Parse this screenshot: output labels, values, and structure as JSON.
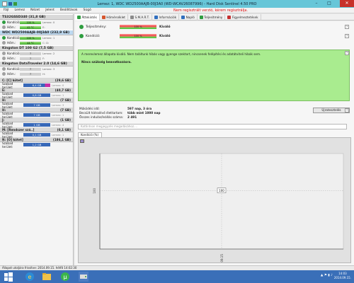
{
  "window": {
    "title": "Lemez: 1, WDC WD2500AAJB-00J3A0 (WD-WCAV26087996) - Hard Disk Sentinel 4.50 PRO",
    "min": "–",
    "max": "□",
    "close": "✕"
  },
  "menu": [
    "Fájl",
    "Lemez",
    "Nézet",
    "Jelent",
    "Beállítások",
    "Súgó"
  ],
  "nag": "Nem regisztrált verzió, kérem regisztrálja.",
  "devices": [
    {
      "name": "TS32GSSD340 (31,8 GB)",
      "selected": false,
      "rows": [
        {
          "label": "Kondíció:",
          "value": "100 %",
          "extra": "Lemez: 0",
          "icon": "#2e9d3f"
        },
        {
          "label": "Hőm.:",
          "value": "42 °C",
          "extra": "E:",
          "icon": "#a0a0a0"
        }
      ]
    },
    {
      "name": "WDC WD2500AAJB-00J3A0 (232,9 GB)",
      "selected": true,
      "rows": [
        {
          "label": "Kondíció:",
          "value": "100 %",
          "extra": "Lemez: 1",
          "icon": "#2e9d3f"
        },
        {
          "label": "Hőm.:",
          "value": "44 °C",
          "extra": "C: D:",
          "icon": "#a0a0a0"
        }
      ]
    },
    {
      "name": "Kingston DT 100 G2 (7,5 GB)",
      "selected": false,
      "rows": [
        {
          "label": "Kondíció:",
          "value": "?",
          "extra": "Lemez: 2",
          "icon": "#a0a0a0"
        },
        {
          "label": "Hőm.:",
          "value": "?",
          "extra": "F:",
          "icon": "#a0a0a0"
        }
      ]
    },
    {
      "name": "Kingston DataTraveler 2.0 (14,6 GB)",
      "selected": false,
      "rows": [
        {
          "label": "Kondíció:",
          "value": "?",
          "extra": "Lemez: 3",
          "icon": "#a0a0a0"
        },
        {
          "label": "Hőm.:",
          "value": "?",
          "extra": "H:",
          "icon": "#a0a0a0"
        }
      ]
    }
  ],
  "volumes": [
    {
      "name": "C: [C] kötet]",
      "size": "(29,6 GB)",
      "label": "Szabad terület:",
      "free": "6,4 GB",
      "extra": "Lemez: 0",
      "pink": true
    },
    {
      "name": "E:",
      "size": "(40,7 GB)",
      "label": "Szabad terület:",
      "free": "0,8 GB",
      "extra": "Lemez: 1",
      "pink": false
    },
    {
      "name": "H:",
      "size": "(7 GB)",
      "label": "Szabad terület:",
      "free": "7 GB",
      "extra": "Lemez: 3",
      "pink": false
    },
    {
      "name": "H:",
      "size": "(7 GB)",
      "label": "Szabad terület:",
      "free": "7 GB",
      "extra": "Lemez: 1",
      "pink": false
    },
    {
      "name": "J:",
      "size": "(1 GB)",
      "label": "Szabad terület:",
      "free": "1 GB",
      "extra": "Lemez: 4",
      "pink": false
    },
    {
      "name": "M: [Rendszer szá..]",
      "size": "(0,1 GB)",
      "label": "Szabad terület:",
      "free": "0,1 GB",
      "extra": "Lemez: 1",
      "pink": false
    },
    {
      "name": "N: [O] kötet]",
      "size": "(186,1 GB)",
      "label": "Szabad terület:",
      "free": "1,2 GB",
      "extra": "",
      "pink": false
    }
  ],
  "tabs": [
    {
      "label": "Áttekintés",
      "color": "#2e9d3f",
      "active": true
    },
    {
      "label": "Hőmérséklet",
      "color": "#d6552c",
      "active": false
    },
    {
      "label": "S.M.A.R.T.",
      "color": "#8a8a8a",
      "active": false
    },
    {
      "label": "Információk",
      "color": "#2f6fbf",
      "active": false
    },
    {
      "label": "Napló",
      "color": "#2f6fbf",
      "active": false
    },
    {
      "label": "Teljesítmény",
      "color": "#2e9d3f",
      "active": false
    },
    {
      "label": "Figyelmeztetések",
      "color": "#c53030",
      "active": false
    }
  ],
  "overview": {
    "perf_label": "Teljesítmény:",
    "perf_value": "100 %",
    "perf_status": "Kiváló",
    "cond_label": "Kondíció:",
    "cond_value": "100 %",
    "cond_status": "Kiváló",
    "info_text": "A merevlemez állapota kiváló. Nem találtunk hibás vagy gyenge szektort, nincsenek felépítési és adatátviteli hibák sem.",
    "info_bold": "Nincs szükség beavatkozásra.",
    "power_on_label": "Működési idő:",
    "power_on_value": "597 nap, 3 óra",
    "remaining_label": "Becsült hátralévő élettartam:",
    "remaining_value": "több mint 1000 nap",
    "starts_label": "Összes indulás/leállás száma:",
    "starts_value": "2 491",
    "repeat_btn": "Újratesztelés",
    "comment_placeholder": "Kattintson megjegyzés megadásához....",
    "chart_tab": "Kondíció  (%)"
  },
  "chart_data": {
    "type": "line",
    "x": [
      "2014.09.15"
    ],
    "series": [
      {
        "values": [
          100
        ]
      }
    ],
    "ylabel": "100",
    "point_label": "100"
  },
  "statusbar": "Állapot utoljára frissítve: 2014.09.15. hétfő 14:02:30",
  "taskbar": {
    "time": "14:03",
    "date": "2014.09.15."
  }
}
